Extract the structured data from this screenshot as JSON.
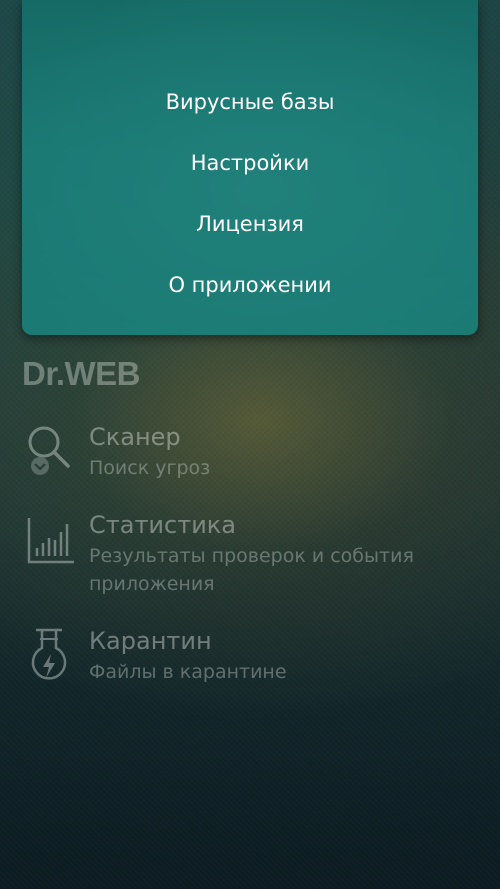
{
  "brand": {
    "logo_text": "Dr.WEB"
  },
  "nav": {
    "items": [
      {
        "title": "Сканер",
        "subtitle": "Поиск угроз",
        "icon": "magnifier-scan-icon"
      },
      {
        "title": "Статистика",
        "subtitle": "Результаты проверок и события приложения",
        "icon": "bar-chart-icon"
      },
      {
        "title": "Карантин",
        "subtitle": "Файлы в карантине",
        "icon": "flask-icon"
      }
    ]
  },
  "menu": {
    "items": [
      {
        "label": "Вирусные базы"
      },
      {
        "label": "Настройки"
      },
      {
        "label": "Лицензия"
      },
      {
        "label": "О приложении"
      }
    ]
  },
  "colors": {
    "menu_background": "#1a7873",
    "menu_text": "#ffffff",
    "background_dark": "#12262a"
  }
}
